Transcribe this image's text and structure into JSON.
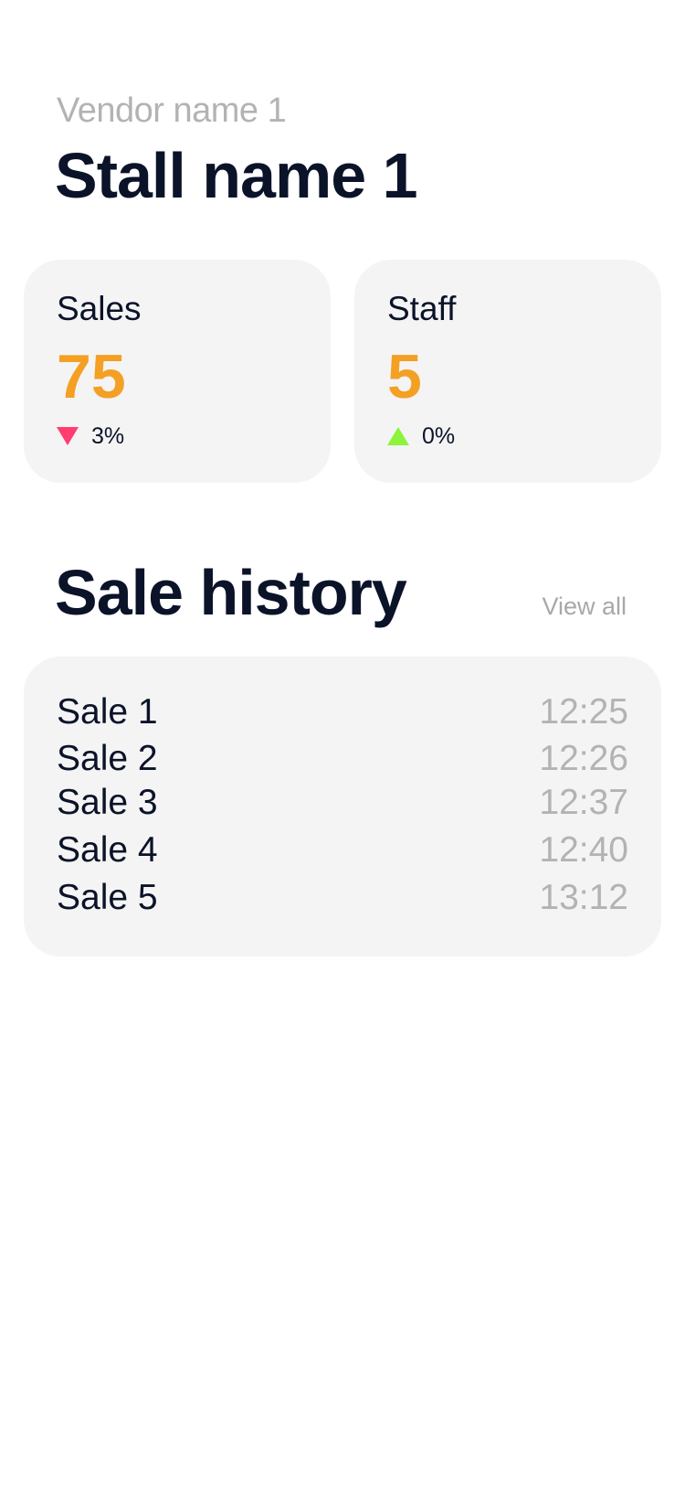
{
  "header": {
    "vendor_name": "Vendor name 1",
    "stall_name": "Stall name 1"
  },
  "stats": {
    "sales": {
      "label": "Sales",
      "value": "75",
      "change": "3%",
      "trend": "down",
      "trend_color": "#ff3d71"
    },
    "staff": {
      "label": "Staff",
      "value": "5",
      "change": "0%",
      "trend": "up",
      "trend_color": "#8cf43c"
    }
  },
  "sale_history": {
    "title": "Sale history",
    "view_all_label": "View all",
    "items": [
      {
        "name": "Sale 1",
        "time": "12:25"
      },
      {
        "name": "Sale 2",
        "time": "12:26"
      },
      {
        "name": "Sale 3",
        "time": "12:37"
      },
      {
        "name": "Sale 4",
        "time": "12:40"
      },
      {
        "name": "Sale 5",
        "time": "13:12"
      }
    ]
  },
  "colors": {
    "accent": "#f4a024",
    "text_primary": "#0b1329",
    "text_muted": "#b3b3b3",
    "card_background": "#f4f4f4"
  }
}
